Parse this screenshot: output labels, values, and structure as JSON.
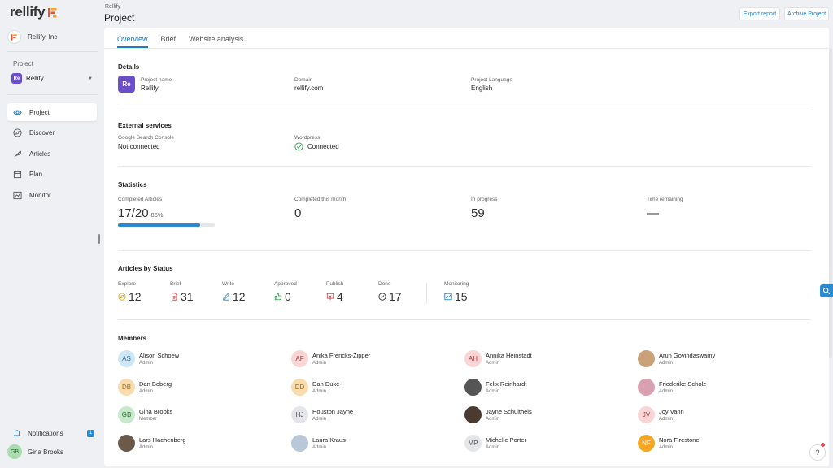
{
  "brand": {
    "name": "rellify",
    "accent": "#1e7cc2",
    "purple": "#6b4fc9"
  },
  "sidebar": {
    "org_name": "Rellify, Inc",
    "project_heading": "Project",
    "project_badge": "Re",
    "project_name": "Rellify",
    "nav": [
      {
        "label": "Project",
        "icon": "eye-icon"
      },
      {
        "label": "Discover",
        "icon": "compass-icon"
      },
      {
        "label": "Articles",
        "icon": "feather-icon"
      },
      {
        "label": "Plan",
        "icon": "calendar-icon"
      },
      {
        "label": "Monitor",
        "icon": "chart-icon"
      }
    ],
    "notifications_label": "Notifications",
    "notifications_count": "1",
    "user_initials": "GB",
    "user_name": "Gina Brooks"
  },
  "header": {
    "breadcrumb": "Rellify",
    "title": "Project",
    "export_label": "Export report",
    "archive_label": "Archive Project"
  },
  "tabs": [
    "Overview",
    "Brief",
    "Website analysis"
  ],
  "details": {
    "title": "Details",
    "badge": "Re",
    "project_name_label": "Project name",
    "project_name": "Rellify",
    "domain_label": "Domain",
    "domain": "rellify.com",
    "language_label": "Project Language",
    "language": "English"
  },
  "external": {
    "title": "External services",
    "gsc_label": "Google Search Console",
    "gsc_value": "Not connected",
    "wp_label": "Wordpress",
    "wp_value": "Connected"
  },
  "statistics": {
    "title": "Statistics",
    "completed_label": "Completed Articles",
    "completed_value": "17/20",
    "completed_pct": "85%",
    "progress": 0.85,
    "month_label": "Completed this month",
    "month_value": "0",
    "progress_label": "In progress",
    "progress_value": "59",
    "remaining_label": "Time remaining",
    "remaining_value": "—"
  },
  "status": {
    "title": "Articles by Status",
    "items": [
      {
        "label": "Explore",
        "value": "12",
        "icon": "explore-icon",
        "color": "#e0a21b"
      },
      {
        "label": "Brief",
        "value": "31",
        "icon": "brief-icon",
        "color": "#d9363e"
      },
      {
        "label": "Write",
        "value": "12",
        "icon": "pencil-icon",
        "color": "#2a8bd0"
      },
      {
        "label": "Approved",
        "value": "0",
        "icon": "thumbs-up-icon",
        "color": "#2e9e4e"
      },
      {
        "label": "Publish",
        "value": "4",
        "icon": "publish-icon",
        "color": "#d9363e"
      },
      {
        "label": "Done",
        "value": "17",
        "icon": "check-circle-icon",
        "color": "#333333"
      },
      {
        "label": "Monitoring",
        "value": "15",
        "icon": "monitoring-icon",
        "color": "#1e7cc2"
      }
    ]
  },
  "members": {
    "title": "Members",
    "list": [
      {
        "name": "Alison Schoew",
        "role": "Admin",
        "initials": "AS",
        "bg": "#cfe6f5",
        "fg": "#2a6d9c"
      },
      {
        "name": "Anika Frericks-Zipper",
        "role": "Admin",
        "initials": "AF",
        "bg": "#f9d5d5",
        "fg": "#b23c3c"
      },
      {
        "name": "Annika Heinstadt",
        "role": "Admin",
        "initials": "AH",
        "bg": "#f9d5d5",
        "fg": "#b23c3c"
      },
      {
        "name": "Arun Govindaswamy",
        "role": "Admin",
        "initials": "",
        "bg": "#c9a27a",
        "fg": "#fff"
      },
      {
        "name": "Dan Boberg",
        "role": "Admin",
        "initials": "DB",
        "bg": "#f8dcae",
        "fg": "#9c6a1a"
      },
      {
        "name": "Dan Duke",
        "role": "Admin",
        "initials": "DD",
        "bg": "#f8dcae",
        "fg": "#9c6a1a"
      },
      {
        "name": "Felix Reinhardt",
        "role": "Admin",
        "initials": "",
        "bg": "#555555",
        "fg": "#fff"
      },
      {
        "name": "Friederike Scholz",
        "role": "Admin",
        "initials": "",
        "bg": "#d8a0b0",
        "fg": "#fff"
      },
      {
        "name": "Gina Brooks",
        "role": "Member",
        "initials": "GB",
        "bg": "#c6eac9",
        "fg": "#2f6a35"
      },
      {
        "name": "Houston Jayne",
        "role": "Admin",
        "initials": "HJ",
        "bg": "#e4e6e9",
        "fg": "#555"
      },
      {
        "name": "Jayne Schultheis",
        "role": "Admin",
        "initials": "",
        "bg": "#4a3a30",
        "fg": "#fff"
      },
      {
        "name": "Joy Vann",
        "role": "Admin",
        "initials": "JV",
        "bg": "#f9d5d5",
        "fg": "#b23c3c"
      },
      {
        "name": "Lars Hachenberg",
        "role": "Admin",
        "initials": "",
        "bg": "#6b5a4a",
        "fg": "#fff"
      },
      {
        "name": "Laura Kraus",
        "role": "Admin",
        "initials": "",
        "bg": "#b8c8d8",
        "fg": "#fff"
      },
      {
        "name": "Michelle Porter",
        "role": "Admin",
        "initials": "MP",
        "bg": "#e4e6e9",
        "fg": "#555"
      },
      {
        "name": "Nora Firestone",
        "role": "Admin",
        "initials": "NF",
        "bg": "#f5a623",
        "fg": "#fff"
      }
    ]
  },
  "help_label": "?"
}
